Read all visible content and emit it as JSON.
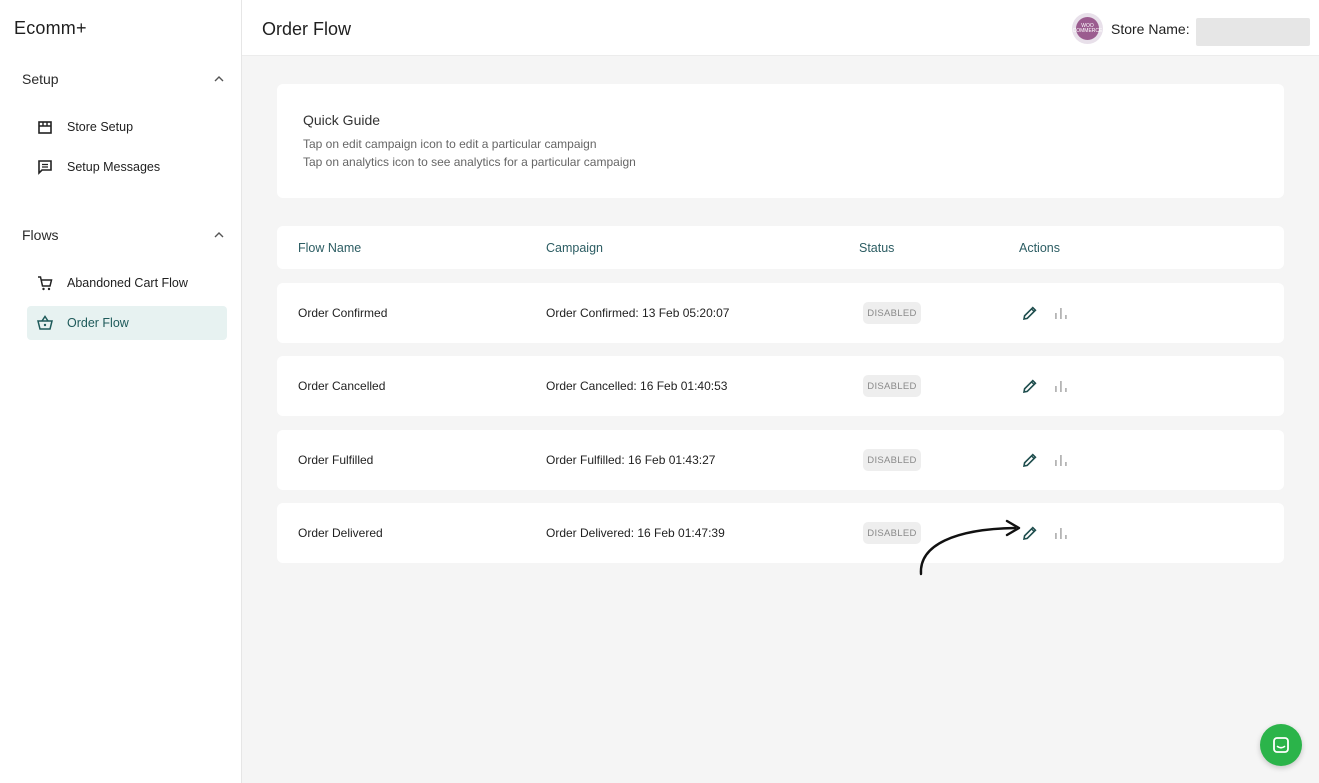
{
  "app": {
    "brand": "Ecomm+"
  },
  "sidebar": {
    "sections": [
      {
        "label": "Setup",
        "items": [
          {
            "label": "Store Setup",
            "icon": "store-icon",
            "active": false
          },
          {
            "label": "Setup Messages",
            "icon": "message-icon",
            "active": false
          }
        ]
      },
      {
        "label": "Flows",
        "items": [
          {
            "label": "Abandoned Cart Flow",
            "icon": "cart-icon",
            "active": false
          },
          {
            "label": "Order Flow",
            "icon": "basket-icon",
            "active": true
          }
        ]
      }
    ]
  },
  "header": {
    "title": "Order Flow",
    "store_label": "Store Name:",
    "store_logo_text": "WOO COMMERCE",
    "store_value": ""
  },
  "guide": {
    "title": "Quick Guide",
    "lines": [
      "Tap on edit campaign icon to edit a particular campaign",
      "Tap on analytics icon to see analytics for a particular campaign"
    ]
  },
  "table": {
    "columns": [
      "Flow Name",
      "Campaign",
      "Status",
      "Actions"
    ],
    "rows": [
      {
        "flow": "Order Confirmed",
        "campaign": "Order Confirmed: 13 Feb 05:20:07",
        "status": "DISABLED"
      },
      {
        "flow": "Order Cancelled",
        "campaign": "Order Cancelled: 16 Feb 01:40:53",
        "status": "DISABLED"
      },
      {
        "flow": "Order Fulfilled",
        "campaign": "Order Fulfilled: 16 Feb 01:43:27",
        "status": "DISABLED"
      },
      {
        "flow": "Order Delivered",
        "campaign": "Order Delivered: 16 Feb 01:47:39",
        "status": "DISABLED"
      }
    ]
  },
  "colors": {
    "accent": "#1e5a5a",
    "active_bg": "#e7f2f1",
    "chat_button": "#2bb44a",
    "badge_bg": "#eeeeee"
  }
}
